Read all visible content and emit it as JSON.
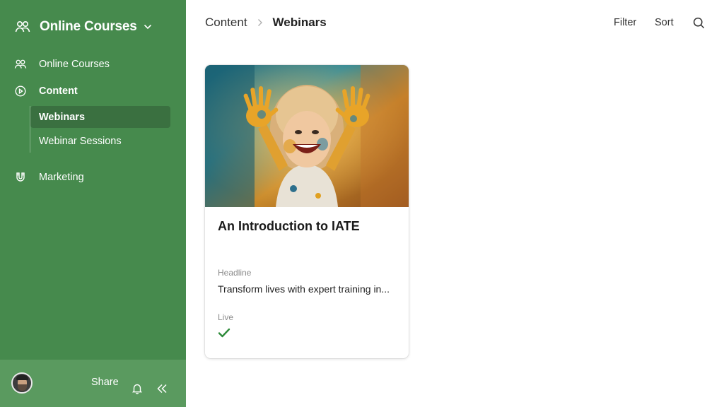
{
  "sidebar": {
    "workspace_title": "Online Courses",
    "nav": {
      "online_courses": "Online Courses",
      "content": "Content",
      "marketing": "Marketing"
    },
    "subnav": {
      "webinars": "Webinars",
      "webinar_sessions": "Webinar Sessions"
    },
    "footer": {
      "share_label": "Share"
    },
    "bg_color": "#468a4d",
    "active_color": "#3a7040"
  },
  "header": {
    "breadcrumb_parent": "Content",
    "breadcrumb_current": "Webinars",
    "filter_label": "Filter",
    "sort_label": "Sort"
  },
  "cards": [
    {
      "title": "An Introduction to IATE",
      "headline_label": "Headline",
      "headline_value": "Transform lives with expert training in...",
      "live_label": "Live",
      "live": true
    }
  ],
  "icons": {
    "workspace": "people-group-icon",
    "online_courses": "people-group-icon",
    "content": "play-circle-icon",
    "marketing": "magnet-icon",
    "bell": "bell-icon",
    "collapse": "double-chevron-left-icon",
    "search": "search-icon",
    "live_check": "checkmark-icon"
  },
  "accent_check_color": "#2e8b3a"
}
